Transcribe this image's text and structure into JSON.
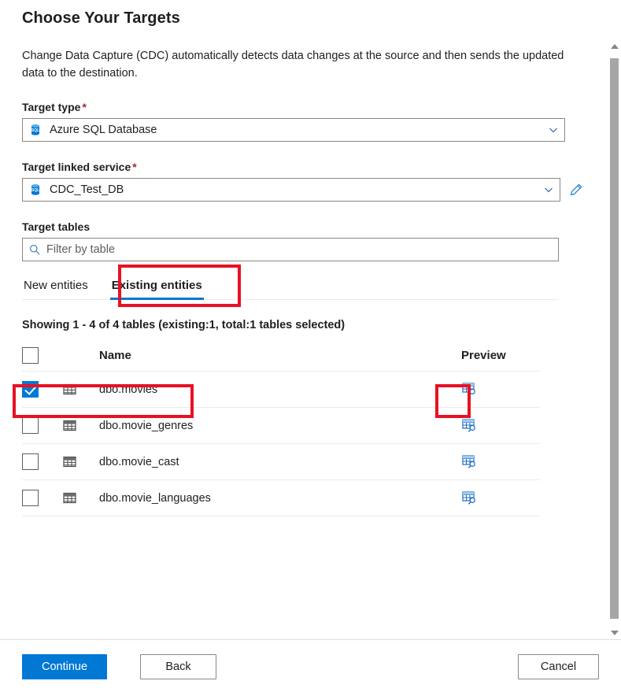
{
  "header": {
    "title": "Choose Your Targets",
    "description": "Change Data Capture (CDC) automatically detects data changes at the source and then sends the updated data to the destination."
  },
  "form": {
    "target_type": {
      "label": "Target type",
      "required_marker": "*",
      "value": "Azure SQL Database",
      "icon": "azure-sql-database-icon",
      "chevron": "chevron-down-icon"
    },
    "target_linked_service": {
      "label": "Target linked service",
      "required_marker": "*",
      "value": "CDC_Test_DB",
      "icon": "azure-sql-database-icon",
      "chevron": "chevron-down-icon",
      "edit_icon": "pencil-icon"
    },
    "target_tables": {
      "label": "Target tables",
      "filter_placeholder": "Filter by table",
      "filter_value": "",
      "search_icon": "search-icon"
    }
  },
  "tabs": [
    {
      "label": "New entities",
      "active": false
    },
    {
      "label": "Existing entities",
      "active": true
    }
  ],
  "table": {
    "showing_text": "Showing 1 - 4 of 4 tables (existing:1, total:1 tables selected)",
    "columns": {
      "select_all": "",
      "name": "Name",
      "preview": "Preview"
    },
    "select_all_checked": false,
    "rows": [
      {
        "checked": true,
        "icon": "table-grid-icon",
        "name": "dbo.movies",
        "preview_icon": "table-preview-icon"
      },
      {
        "checked": false,
        "icon": "table-grid-icon",
        "name": "dbo.movie_genres",
        "preview_icon": "table-preview-icon"
      },
      {
        "checked": false,
        "icon": "table-grid-icon",
        "name": "dbo.movie_cast",
        "preview_icon": "table-preview-icon"
      },
      {
        "checked": false,
        "icon": "table-grid-icon",
        "name": "dbo.movie_languages",
        "preview_icon": "table-preview-icon"
      }
    ]
  },
  "footer": {
    "continue_label": "Continue",
    "back_label": "Back",
    "cancel_label": "Cancel"
  },
  "scrollbar": {
    "up_icon": "scroll-up-arrow-icon",
    "down_icon": "scroll-down-arrow-icon"
  },
  "annotations": [
    {
      "name": "highlight-existing-entities-tab"
    },
    {
      "name": "highlight-selected-table-row"
    },
    {
      "name": "highlight-preview-icon"
    }
  ],
  "colors": {
    "accent": "#0078d4",
    "annotation": "#e81123",
    "required": "#a4262c",
    "text": "#201f1e",
    "placeholder": "#605e5c",
    "border": "#8a8886",
    "divider": "#edebe9"
  }
}
